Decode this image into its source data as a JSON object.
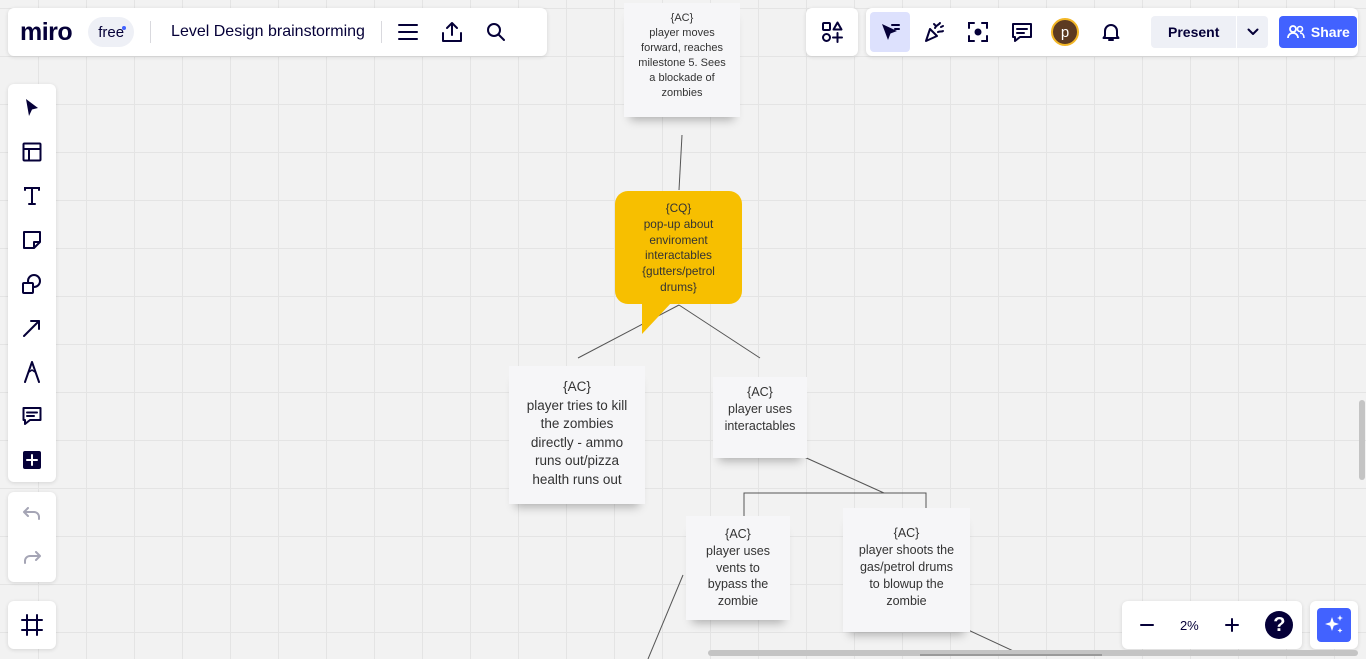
{
  "app": {
    "logo": "miro",
    "plan_badge": "free",
    "board_title": "Level Design brainstorming"
  },
  "toolbar": {
    "menu_icon": "hamburger-icon",
    "export_icon": "upload-icon",
    "search_icon": "search-icon"
  },
  "collab": {
    "apps_icon": "shapes-apps-icon",
    "avatar_initial": "p",
    "present_label": "Present",
    "share_label": "Share"
  },
  "left_tools": [
    "select-tool",
    "templates-tool",
    "text-tool",
    "sticky-note-tool",
    "shapes-tool",
    "connection-line-tool",
    "pen-tool",
    "comment-tool",
    "add-more-tool"
  ],
  "zoom": {
    "value": "2%",
    "help_label": "?"
  },
  "canvas": {
    "notes": [
      {
        "tag": "{AC}",
        "text": "player moves\nforward, reaches\nmilestone 5. Sees\na blockade of\nzombies"
      },
      {
        "tag": "{AC}",
        "text": "player tries to kill\nthe zombies\ndirectly - ammo\nruns out/pizza\nhealth runs out"
      },
      {
        "tag": "{AC}",
        "text": "player uses\ninteractables"
      },
      {
        "tag": "{AC}",
        "text": "player uses\nvents to\nbypass the\nzombie"
      },
      {
        "tag": "{AC}",
        "text": "player  shoots the\ngas/petrol drums\nto blowup the\nzombie"
      }
    ],
    "callout": {
      "tag": "{CQ}",
      "text": "pop-up about\nenviroment\ninteractables\n{gutters/petrol\ndrums}",
      "color": "#f7bf00"
    }
  },
  "colors": {
    "accent": "#4262ff",
    "ink": "#050038",
    "canvas": "#f2f2f2"
  }
}
